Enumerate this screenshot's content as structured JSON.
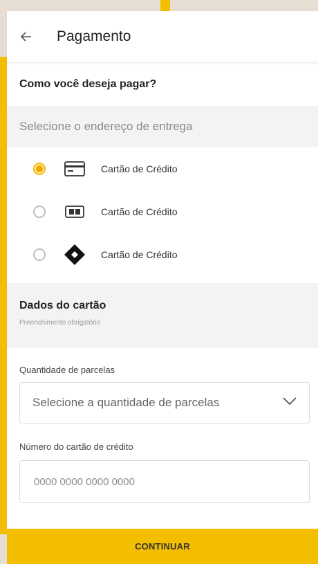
{
  "header": {
    "title": "Pagamento",
    "back_icon": "arrow-left-icon"
  },
  "payment": {
    "question": "Como você deseja pagar?",
    "address_placeholder": "Selecione o endereço de entrega",
    "options": [
      {
        "label": "Cartão de Crédito",
        "icon": "credit-card-icon",
        "selected": true
      },
      {
        "label": "Cartão de Crédito",
        "icon": "card-chip-icon",
        "selected": false
      },
      {
        "label": "Cartão de Crédito",
        "icon": "diamond-card-icon",
        "selected": false
      }
    ]
  },
  "card_data": {
    "title": "Dados do cartão",
    "subtitle": "Preenchimento obrigatório",
    "installments_label": "Quantidade de parcelas",
    "installments_placeholder": "Selecione a quantidade de parcelas",
    "card_number_label": "Número do cartão de crédito",
    "card_number_placeholder": "0000 0000 0000 0000"
  },
  "actions": {
    "continue_label": "CONTINUAR"
  },
  "colors": {
    "accent": "#f3bd00",
    "background": "#e6ddd3"
  }
}
